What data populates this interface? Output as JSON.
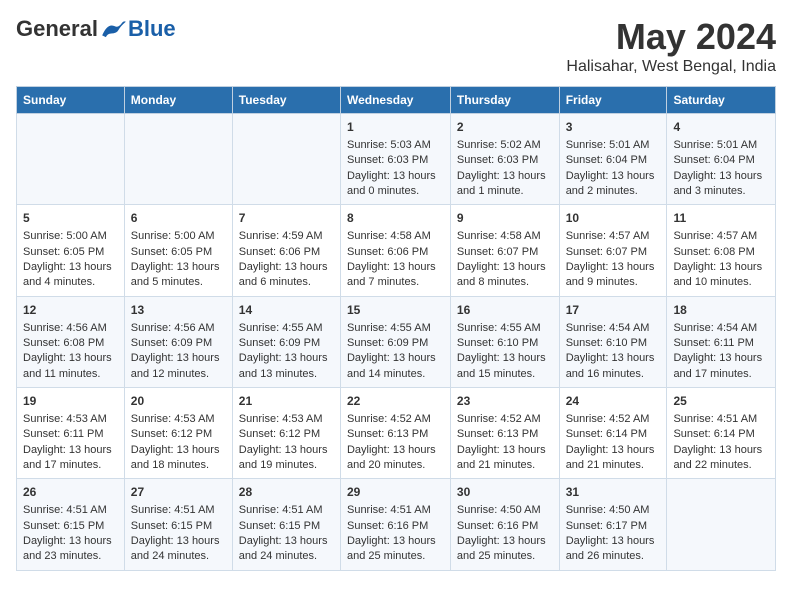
{
  "logo": {
    "general": "General",
    "blue": "Blue"
  },
  "title": "May 2024",
  "subtitle": "Halisahar, West Bengal, India",
  "days_of_week": [
    "Sunday",
    "Monday",
    "Tuesday",
    "Wednesday",
    "Thursday",
    "Friday",
    "Saturday"
  ],
  "weeks": [
    [
      {
        "day": "",
        "content": ""
      },
      {
        "day": "",
        "content": ""
      },
      {
        "day": "",
        "content": ""
      },
      {
        "day": "1",
        "content": "Sunrise: 5:03 AM\nSunset: 6:03 PM\nDaylight: 13 hours\nand 0 minutes."
      },
      {
        "day": "2",
        "content": "Sunrise: 5:02 AM\nSunset: 6:03 PM\nDaylight: 13 hours\nand 1 minute."
      },
      {
        "day": "3",
        "content": "Sunrise: 5:01 AM\nSunset: 6:04 PM\nDaylight: 13 hours\nand 2 minutes."
      },
      {
        "day": "4",
        "content": "Sunrise: 5:01 AM\nSunset: 6:04 PM\nDaylight: 13 hours\nand 3 minutes."
      }
    ],
    [
      {
        "day": "5",
        "content": "Sunrise: 5:00 AM\nSunset: 6:05 PM\nDaylight: 13 hours\nand 4 minutes."
      },
      {
        "day": "6",
        "content": "Sunrise: 5:00 AM\nSunset: 6:05 PM\nDaylight: 13 hours\nand 5 minutes."
      },
      {
        "day": "7",
        "content": "Sunrise: 4:59 AM\nSunset: 6:06 PM\nDaylight: 13 hours\nand 6 minutes."
      },
      {
        "day": "8",
        "content": "Sunrise: 4:58 AM\nSunset: 6:06 PM\nDaylight: 13 hours\nand 7 minutes."
      },
      {
        "day": "9",
        "content": "Sunrise: 4:58 AM\nSunset: 6:07 PM\nDaylight: 13 hours\nand 8 minutes."
      },
      {
        "day": "10",
        "content": "Sunrise: 4:57 AM\nSunset: 6:07 PM\nDaylight: 13 hours\nand 9 minutes."
      },
      {
        "day": "11",
        "content": "Sunrise: 4:57 AM\nSunset: 6:08 PM\nDaylight: 13 hours\nand 10 minutes."
      }
    ],
    [
      {
        "day": "12",
        "content": "Sunrise: 4:56 AM\nSunset: 6:08 PM\nDaylight: 13 hours\nand 11 minutes."
      },
      {
        "day": "13",
        "content": "Sunrise: 4:56 AM\nSunset: 6:09 PM\nDaylight: 13 hours\nand 12 minutes."
      },
      {
        "day": "14",
        "content": "Sunrise: 4:55 AM\nSunset: 6:09 PM\nDaylight: 13 hours\nand 13 minutes."
      },
      {
        "day": "15",
        "content": "Sunrise: 4:55 AM\nSunset: 6:09 PM\nDaylight: 13 hours\nand 14 minutes."
      },
      {
        "day": "16",
        "content": "Sunrise: 4:55 AM\nSunset: 6:10 PM\nDaylight: 13 hours\nand 15 minutes."
      },
      {
        "day": "17",
        "content": "Sunrise: 4:54 AM\nSunset: 6:10 PM\nDaylight: 13 hours\nand 16 minutes."
      },
      {
        "day": "18",
        "content": "Sunrise: 4:54 AM\nSunset: 6:11 PM\nDaylight: 13 hours\nand 17 minutes."
      }
    ],
    [
      {
        "day": "19",
        "content": "Sunrise: 4:53 AM\nSunset: 6:11 PM\nDaylight: 13 hours\nand 17 minutes."
      },
      {
        "day": "20",
        "content": "Sunrise: 4:53 AM\nSunset: 6:12 PM\nDaylight: 13 hours\nand 18 minutes."
      },
      {
        "day": "21",
        "content": "Sunrise: 4:53 AM\nSunset: 6:12 PM\nDaylight: 13 hours\nand 19 minutes."
      },
      {
        "day": "22",
        "content": "Sunrise: 4:52 AM\nSunset: 6:13 PM\nDaylight: 13 hours\nand 20 minutes."
      },
      {
        "day": "23",
        "content": "Sunrise: 4:52 AM\nSunset: 6:13 PM\nDaylight: 13 hours\nand 21 minutes."
      },
      {
        "day": "24",
        "content": "Sunrise: 4:52 AM\nSunset: 6:14 PM\nDaylight: 13 hours\nand 21 minutes."
      },
      {
        "day": "25",
        "content": "Sunrise: 4:51 AM\nSunset: 6:14 PM\nDaylight: 13 hours\nand 22 minutes."
      }
    ],
    [
      {
        "day": "26",
        "content": "Sunrise: 4:51 AM\nSunset: 6:15 PM\nDaylight: 13 hours\nand 23 minutes."
      },
      {
        "day": "27",
        "content": "Sunrise: 4:51 AM\nSunset: 6:15 PM\nDaylight: 13 hours\nand 24 minutes."
      },
      {
        "day": "28",
        "content": "Sunrise: 4:51 AM\nSunset: 6:15 PM\nDaylight: 13 hours\nand 24 minutes."
      },
      {
        "day": "29",
        "content": "Sunrise: 4:51 AM\nSunset: 6:16 PM\nDaylight: 13 hours\nand 25 minutes."
      },
      {
        "day": "30",
        "content": "Sunrise: 4:50 AM\nSunset: 6:16 PM\nDaylight: 13 hours\nand 25 minutes."
      },
      {
        "day": "31",
        "content": "Sunrise: 4:50 AM\nSunset: 6:17 PM\nDaylight: 13 hours\nand 26 minutes."
      },
      {
        "day": "",
        "content": ""
      }
    ]
  ]
}
